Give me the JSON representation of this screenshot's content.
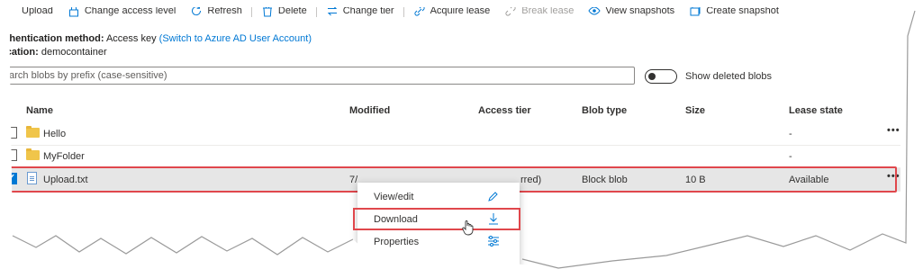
{
  "toolbar": {
    "upload": "Upload",
    "change_access_level": "Change access level",
    "refresh": "Refresh",
    "delete": "Delete",
    "change_tier": "Change tier",
    "acquire_lease": "Acquire lease",
    "break_lease": "Break lease",
    "view_snapshots": "View snapshots",
    "create_snapshot": "Create snapshot"
  },
  "info": {
    "auth_label": "uthentication method:",
    "auth_value": "Access key",
    "auth_link": "(Switch to Azure AD User Account)",
    "location_label": "ocation:",
    "location_value": "democontainer"
  },
  "search": {
    "placeholder": "earch blobs by prefix (case-sensitive)"
  },
  "toggle": {
    "label": "Show deleted blobs",
    "on": false
  },
  "table": {
    "headers": {
      "name": "Name",
      "modified": "Modified",
      "access_tier": "Access tier",
      "blob_type": "Blob type",
      "size": "Size",
      "lease_state": "Lease state"
    },
    "rows": [
      {
        "name": "Hello",
        "modified": "",
        "access_tier": "",
        "blob_type": "",
        "size": "",
        "lease_state": "-",
        "kind": "folder",
        "checked": false
      },
      {
        "name": "MyFolder",
        "modified": "",
        "access_tier": "",
        "blob_type": "",
        "size": "",
        "lease_state": "-",
        "kind": "folder",
        "checked": false
      },
      {
        "name": "Upload.txt",
        "modified": "7/",
        "access_tier": "rred)",
        "blob_type": "Block blob",
        "size": "10 B",
        "lease_state": "Available",
        "kind": "file",
        "checked": true
      }
    ],
    "more_glyph": "•••"
  },
  "context_menu": {
    "items": [
      {
        "label": "View/edit",
        "icon": "pencil-icon"
      },
      {
        "label": "Download",
        "icon": "download-arrow-icon"
      },
      {
        "label": "Properties",
        "icon": "sliders-icon"
      }
    ]
  },
  "colors": {
    "accent": "#0078d4",
    "highlight": "#e0474c",
    "folder": "#f0c54a"
  }
}
